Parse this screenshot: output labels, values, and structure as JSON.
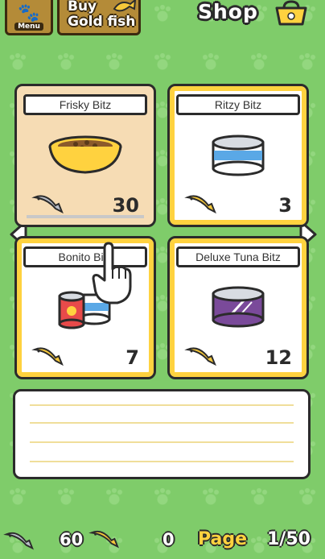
{
  "header": {
    "menu_label": "Menu",
    "gold_fish_line1": "Buy",
    "gold_fish_line2": "Gold fish",
    "title": "Shop"
  },
  "products": [
    {
      "name": "Frisky Bitz",
      "price": "30",
      "currency": "silver-fish",
      "image": "food-bowl-icon",
      "selected": true
    },
    {
      "name": "Ritzy Bitz",
      "price": "3",
      "currency": "gold-fish",
      "image": "blue-can-icon",
      "selected": false
    },
    {
      "name": "Bonito Bitz",
      "price": "7",
      "currency": "gold-fish",
      "image": "red-can-icon",
      "selected": false
    },
    {
      "name": "Deluxe Tuna Bitz",
      "price": "12",
      "currency": "gold-fish",
      "image": "purple-can-icon",
      "selected": false
    }
  ],
  "footer": {
    "silver_fish_count": "60",
    "gold_fish_count": "0",
    "page_label": "Page",
    "page_value": "1/50"
  },
  "colors": {
    "background": "#7fcc6a",
    "card_border": "#ffd23f",
    "selected_card": "#f6dcb4",
    "gold_fish": "#f6c83a",
    "silver_fish": "#b9bec8"
  }
}
